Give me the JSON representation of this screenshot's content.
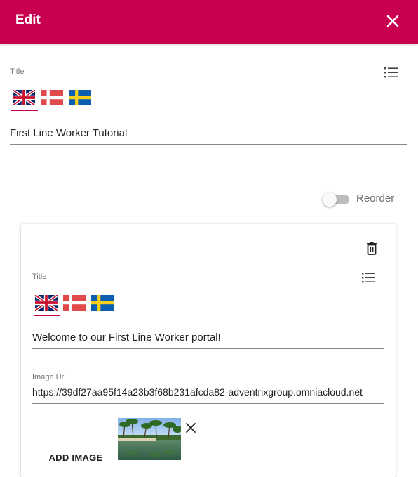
{
  "header": {
    "title": "Edit",
    "background": "#c8004f",
    "close_icon": "close-icon"
  },
  "title_field": {
    "label": "Title",
    "value": "First Line Worker Tutorial",
    "languages": [
      "English (UK)",
      "Danish",
      "Swedish"
    ],
    "active_language": "English (UK)"
  },
  "reorder": {
    "label": "Reorder",
    "enabled": false
  },
  "item_card": {
    "delete_icon": "trash-icon",
    "title_label": "Title",
    "title_value": "Welcome to our First Line Worker portal!",
    "languages": [
      "English (UK)",
      "Danish",
      "Swedish"
    ],
    "active_language": "English (UK)",
    "image_url_label": "Image Url",
    "image_url_value": "https://39df27aa95f14a23b3f68b231afcda82-adventrixgroup.omniacloud.net",
    "add_image_label": "ADD IMAGE",
    "remove_image_icon": "close-icon"
  },
  "colors": {
    "accent": "#c8004f",
    "underline": "#8a8a8a"
  }
}
